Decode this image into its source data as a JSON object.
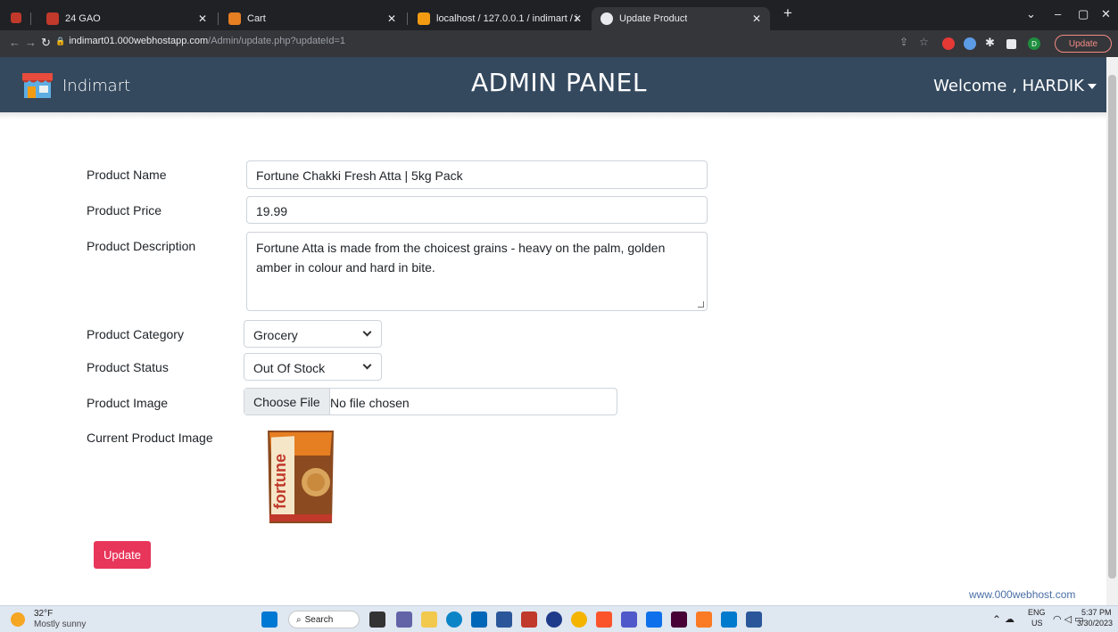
{
  "browser": {
    "tabs": [
      {
        "label": "24 GAO",
        "active": false
      },
      {
        "label": "Cart",
        "active": false
      },
      {
        "label": "localhost / 127.0.0.1 / indimart / i",
        "active": false
      },
      {
        "label": "Update Product",
        "active": true
      }
    ],
    "new_tab": "+",
    "url_host": "indimart01.000webhostapp.com",
    "url_path": "/Admin/update.php?updateId=1",
    "update_button": "Update",
    "profile_initial": "D"
  },
  "navbar": {
    "brand": "Indimart",
    "title": "ADMIN PANEL",
    "welcome": "Welcome , HARDIK"
  },
  "form": {
    "product_name_label": "Product Name",
    "product_name_value": "Fortune Chakki Fresh Atta | 5kg Pack",
    "product_price_label": "Product Price",
    "product_price_value": "19.99",
    "product_description_label": "Product Description",
    "product_description_value": "Fortune Atta is made from the choicest grains - heavy on the palm, golden amber in colour and hard in bite.",
    "product_category_label": "Product Category",
    "product_category_value": "Grocery",
    "product_status_label": "Product Status",
    "product_status_value": "Out Of Stock",
    "product_image_label": "Product Image",
    "choose_file_label": "Choose File",
    "no_file_label": "No file chosen",
    "current_image_label": "Current Product Image",
    "update_button": "Update"
  },
  "footer_link": "www.000webhost.com",
  "taskbar": {
    "temperature": "32°F",
    "weather": "Mostly sunny",
    "search": "Search",
    "lang_top": "ENG",
    "lang_bottom": "US",
    "time": "5:37 PM",
    "date": "3/30/2023"
  },
  "colors": {
    "navbar_bg": "#34495e",
    "update_button": "#e8355a",
    "browser_dark": "#202124"
  }
}
